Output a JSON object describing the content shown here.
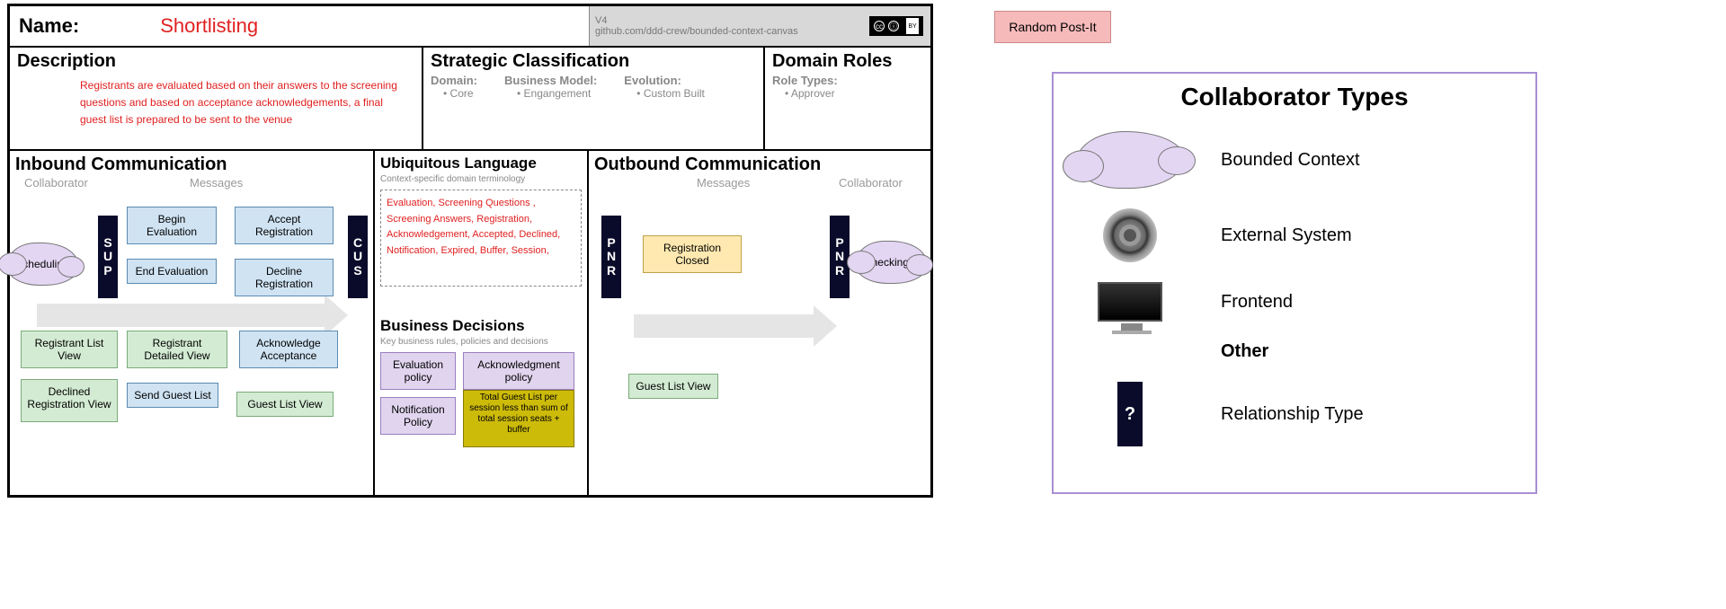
{
  "name": {
    "label": "Name:",
    "value": "Shortlisting"
  },
  "meta": {
    "version": "V4",
    "repo": "github.com/ddd-crew/bounded-context-canvas",
    "license": "cc",
    "by": "BY"
  },
  "description": {
    "heading": "Description",
    "text": "Registrants are evaluated based on their answers to the screening questions and based on acceptance acknowledgements, a final guest list is prepared to be sent to the venue"
  },
  "strategic": {
    "heading": "Strategic Classification",
    "domain_lbl": "Domain:",
    "model_lbl": "Business Model:",
    "evolution_lbl": "Evolution:",
    "domain_val": "Core",
    "model_val": "Engangement",
    "evolution_val": "Custom Built"
  },
  "roles": {
    "heading": "Domain Roles",
    "types_lbl": "Role Types:",
    "role1": "Approver"
  },
  "inbound": {
    "heading": "Inbound Communication",
    "collab_lbl": "Collaborator",
    "msg_lbl": "Messages",
    "collaborator": "Scheduling",
    "rel1": "SUP",
    "rel2": "CUS",
    "msgs": {
      "begin": "Begin Evaluation",
      "accept": "Accept Registration",
      "end": "End Evaluation",
      "decline": "Decline Registration",
      "ack": "Acknowledge Acceptance",
      "reg_list": "Registrant List View",
      "reg_detail": "Registrant Detailed View",
      "decl_view": "Declined Registration View",
      "send_list": "Send Guest List",
      "guest_view": "Guest List View"
    }
  },
  "ubiq": {
    "heading": "Ubiquitous Language",
    "sub": "Context-specific domain terminology",
    "terms": "Evaluation, Screening Questions , Screening Answers, Registration, Acknowledgement, Accepted, Declined, Notification, Expired, Buffer, Session,"
  },
  "biz": {
    "heading": "Business Decisions",
    "sub": "Key business rules, policies and decisions",
    "p1": "Evaluation policy",
    "p2": "Acknowledgment policy",
    "p3": "Notification Policy",
    "rule": "Total Guest List per session less than sum of total session seats + buffer"
  },
  "outbound": {
    "heading": "Outbound Communication",
    "msg_lbl": "Messages",
    "collab_lbl": "Collaborator",
    "rel1": "PNR",
    "rel2": "PNR",
    "collaborator": "CheckingIn",
    "msg1": "Registration Closed",
    "msg2": "Guest List View"
  },
  "postit": "Random Post-It",
  "legend": {
    "title": "Collaborator Types",
    "bc": "Bounded Context",
    "ext": "External System",
    "fe": "Frontend",
    "other": "Other",
    "rt": "Relationship Type",
    "q": "?"
  }
}
